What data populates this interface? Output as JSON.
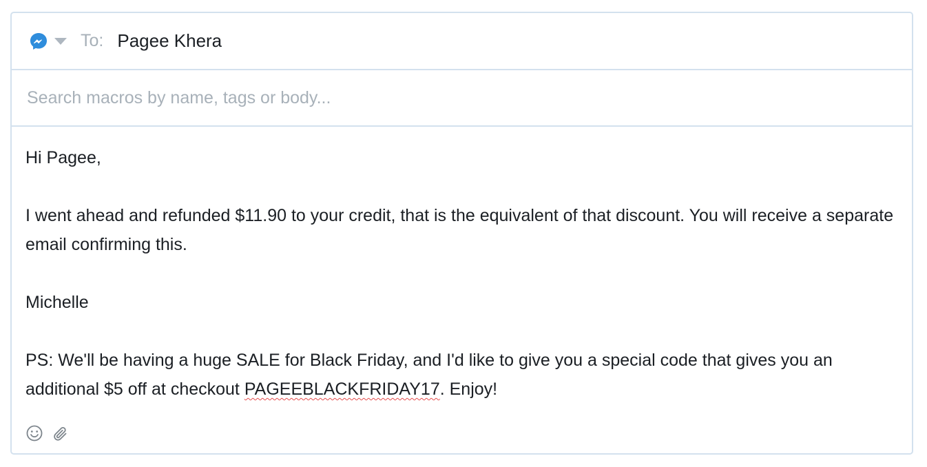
{
  "header": {
    "channel_icon": "messenger-icon",
    "to_label": "To:",
    "recipient": "Pagee Khera"
  },
  "macro_search": {
    "placeholder": "Search macros by name, tags or body..."
  },
  "message": {
    "greeting": "Hi Pagee,",
    "paragraph1": "I went ahead and refunded $11.90 to your credit, that is the equivalent of that discount. You will receive a separate email confirming this.",
    "signature": "Michelle",
    "ps_text": "PS: We'll be having a huge SALE for Black Friday, and I'd like to give you a special code that gives you an additional $5 off at checkout ",
    "promo_code": "PAGEEBLACKFRIDAY17",
    "ps_end": ". Enjoy!"
  },
  "toolbar": {
    "icons": [
      "emoji-icon",
      "paperclip-icon"
    ]
  },
  "colors": {
    "border": "#d3e1ee",
    "messenger_blue": "#2f8ddc",
    "spellcheck": "#e64c4c"
  }
}
